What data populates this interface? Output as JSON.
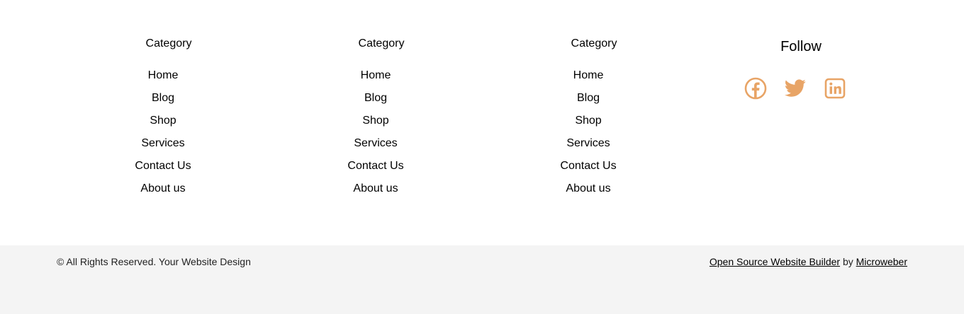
{
  "footer": {
    "columns": [
      {
        "heading": "Category",
        "links": [
          "Home",
          "Blog",
          "Shop",
          "Services",
          "Contact Us",
          "About us"
        ]
      },
      {
        "heading": "Category",
        "links": [
          "Home",
          "Blog",
          "Shop",
          "Services",
          "Contact Us",
          "About us"
        ]
      },
      {
        "heading": "Category",
        "links": [
          "Home",
          "Blog",
          "Shop",
          "Services",
          "Contact Us",
          "About us"
        ]
      }
    ],
    "follow": {
      "title": "Follow",
      "icons": [
        "facebook-icon",
        "twitter-icon",
        "linkedin-icon"
      ],
      "icon_color": "#e8a466"
    }
  },
  "bottom_bar": {
    "copyright": "© All Rights Reserved. Your Website Design",
    "builder_link": "Open Source Website Builder",
    "by_text": "by",
    "microweber_link": "Microweber",
    "background": "#f4f4f4"
  }
}
